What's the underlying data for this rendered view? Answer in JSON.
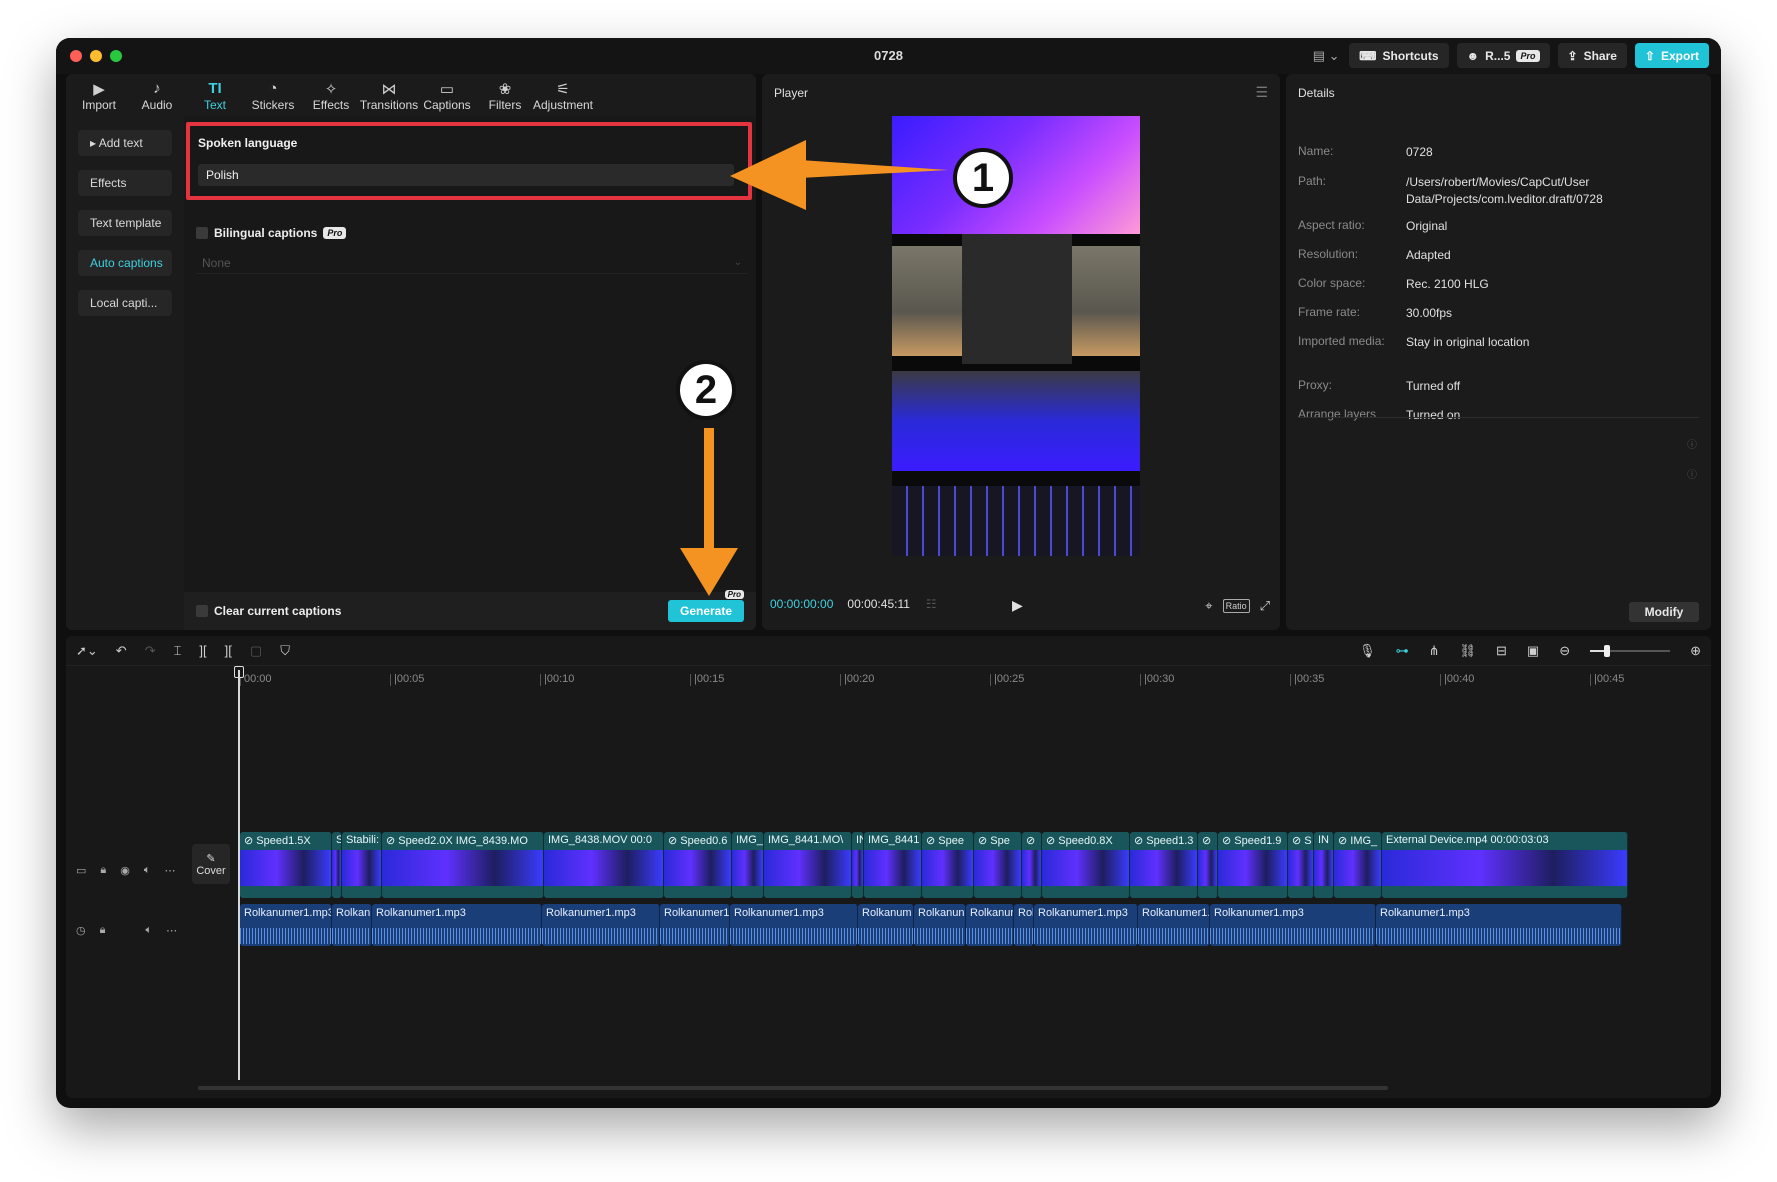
{
  "window": {
    "title": "0728"
  },
  "titlebar": {
    "layout_icon": "layout-icon",
    "shortcuts": "Shortcuts",
    "user": "R...5",
    "pro": "Pro",
    "share": "Share",
    "export": "Export"
  },
  "tools": [
    {
      "label": "Import",
      "icon": "import-icon",
      "glyph": "▶"
    },
    {
      "label": "Audio",
      "icon": "audio-icon",
      "glyph": "♪"
    },
    {
      "label": "Text",
      "icon": "text-icon",
      "glyph": "TI"
    },
    {
      "label": "Stickers",
      "icon": "sticker-icon",
      "glyph": "◔"
    },
    {
      "label": "Effects",
      "icon": "effects-icon",
      "glyph": "✧"
    },
    {
      "label": "Transitions",
      "icon": "transitions-icon",
      "glyph": "⋈"
    },
    {
      "label": "Captions",
      "icon": "captions-icon",
      "glyph": "▭"
    },
    {
      "label": "Filters",
      "icon": "filters-icon",
      "glyph": "❀"
    },
    {
      "label": "Adjustment",
      "icon": "adjustment-icon",
      "glyph": "⚟"
    }
  ],
  "side_nav": [
    "▸ Add text",
    "Effects",
    "Text template",
    "Auto captions",
    "Local capti..."
  ],
  "captions": {
    "spoken_language_label": "Spoken language",
    "spoken_language_value": "Polish",
    "bilingual_label": "Bilingual captions",
    "bilingual_pro": "Pro",
    "bilingual_value": "None",
    "clear_label": "Clear current captions",
    "generate": "Generate",
    "generate_pro": "Pro"
  },
  "player": {
    "title": "Player",
    "current_time": "00:00:00:00",
    "total_time": "00:00:45:11",
    "ratio": "Ratio"
  },
  "details": {
    "title": "Details",
    "rows": [
      {
        "k": "Name:",
        "v": "0728"
      },
      {
        "k": "Path:",
        "v": "/Users/robert/Movies/CapCut/User Data/Projects/com.lveditor.draft/0728"
      },
      {
        "k": "Aspect ratio:",
        "v": "Original"
      },
      {
        "k": "Resolution:",
        "v": "Adapted"
      },
      {
        "k": "Color space:",
        "v": "Rec. 2100 HLG"
      },
      {
        "k": "Frame rate:",
        "v": "30.00fps"
      },
      {
        "k": "Imported media:",
        "v": "Stay in original location"
      },
      {
        "k": "Proxy:",
        "v": "Turned off"
      },
      {
        "k": "Arrange layers",
        "v": "Turned on"
      }
    ],
    "modify": "Modify"
  },
  "timeline": {
    "ticks": [
      "00:00",
      "|00:05",
      "|00:10",
      "|00:15",
      "|00:20",
      "|00:25",
      "|00:30",
      "|00:35",
      "|00:40",
      "|00:45"
    ],
    "cover": "Cover",
    "video_clips": [
      {
        "label": "⊘ Speed1.5X",
        "w": 92
      },
      {
        "label": "S",
        "w": 10
      },
      {
        "label": "Stabili:",
        "w": 40
      },
      {
        "label": "⊘ Speed2.0X  IMG_8439.MO",
        "w": 162
      },
      {
        "label": "IMG_8438.MOV  00:0",
        "w": 120
      },
      {
        "label": "⊘ Speed0.6",
        "w": 68
      },
      {
        "label": "IMG_",
        "w": 32
      },
      {
        "label": "IMG_8441.MO\\",
        "w": 88
      },
      {
        "label": "IN",
        "w": 12
      },
      {
        "label": "IMG_8441",
        "w": 58
      },
      {
        "label": "⊘ Spee",
        "w": 52
      },
      {
        "label": "⊘ Spe",
        "w": 48
      },
      {
        "label": "⊘",
        "w": 20
      },
      {
        "label": "⊘ Speed0.8X",
        "w": 88
      },
      {
        "label": "⊘ Speed1.3",
        "w": 68
      },
      {
        "label": "⊘",
        "w": 20
      },
      {
        "label": "⊘ Speed1.9",
        "w": 70
      },
      {
        "label": "⊘ S",
        "w": 26
      },
      {
        "label": "IN",
        "w": 20
      },
      {
        "label": "⊘ IMG_",
        "w": 48
      },
      {
        "label": "External Device.mp4  00:00:03:03",
        "w": 246
      }
    ],
    "audio_clips": [
      {
        "label": "Rolkanumer1.mp3",
        "w": 92
      },
      {
        "label": "Rolkan",
        "w": 40
      },
      {
        "label": "Rolkanumer1.mp3",
        "w": 170
      },
      {
        "label": "Rolkanumer1.mp3",
        "w": 118
      },
      {
        "label": "Rolkanumer1",
        "w": 70
      },
      {
        "label": "Rolkanumer1.mp3",
        "w": 128
      },
      {
        "label": "Rolkanum",
        "w": 56
      },
      {
        "label": "Rolkanun",
        "w": 52
      },
      {
        "label": "Rolkanur",
        "w": 48
      },
      {
        "label": "Rol",
        "w": 20
      },
      {
        "label": "Rolkanumer1.mp3",
        "w": 104
      },
      {
        "label": "Rolkanumer1.",
        "w": 72
      },
      {
        "label": "Rolkanumer1.mp3",
        "w": 166
      },
      {
        "label": "Rolkanumer1.mp3",
        "w": 246
      }
    ]
  },
  "annotations": {
    "step1": "1",
    "step2": "2"
  }
}
